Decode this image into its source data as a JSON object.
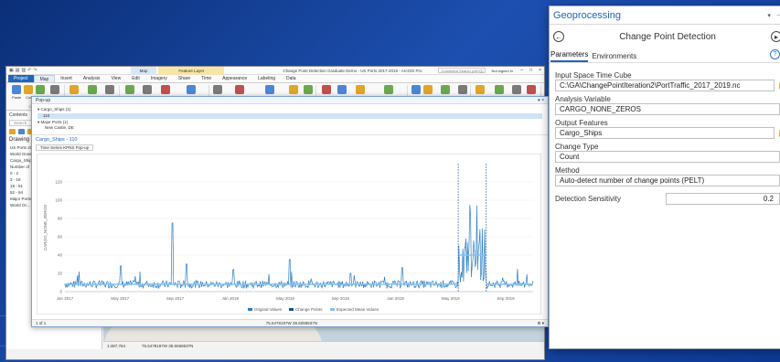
{
  "pro": {
    "window_title": "Change Point Detection Graduate Demo - US Ports 2017-2019 - ArcGIS Pro",
    "context_tabs": [
      "Map",
      "Feature Layer"
    ],
    "tabs": [
      "Project",
      "Map",
      "Insert",
      "Analysis",
      "View",
      "Edit",
      "Imagery",
      "Share",
      "Time",
      "Appearance",
      "Labeling",
      "Data"
    ],
    "active_tab": "Map",
    "search_placeholder": "Command Search (Alt+Q)",
    "signed_in": "Not signed in",
    "ribbon_groups": [
      {
        "name": "Clipboard",
        "tools": [
          "Paste",
          "Cut",
          "Copy",
          "Copy Path"
        ]
      },
      {
        "name": "Navigate",
        "tools": [
          "Explore",
          "Bookmarks",
          "Go To XY"
        ]
      },
      {
        "name": "Layer",
        "tools": [
          "Basemap",
          "Add Data",
          "Add Preset",
          "Add Graphics Layer"
        ]
      },
      {
        "name": "Selection",
        "tools": [
          "Select",
          "Select By Attributes",
          "Select By Location",
          "Attributes",
          "Clear"
        ]
      },
      {
        "name": "Inquiry",
        "tools": [
          "Measure",
          "Locate",
          "Infographics",
          "Coordinate Conversion"
        ]
      },
      {
        "name": "Labeling",
        "tools": [
          "Pause",
          "Lock",
          "View Unplaced",
          "More"
        ]
      },
      {
        "name": "Offline",
        "tools": [
          "Convert",
          "Download Map",
          "Sync",
          "Remove"
        ]
      }
    ],
    "contents": {
      "title": "Contents",
      "search_placeholder": "Search",
      "heading": "Drawing Order",
      "rows": [
        "US Ports 2017-2019",
        "World Ocean Reference",
        "Cargo_Ships",
        "Number of",
        "0 - 2",
        "3 - 18",
        "19 - 51",
        "52 - 94",
        "Major Ports",
        "World Oc..."
      ]
    },
    "map_tabs": [
      "US Ports 2017-2019",
      "Covid-19 Daily Confirmed Cases"
    ],
    "status": {
      "scale": "1:487,764",
      "coords": "75.5478197W 39.6068537N"
    }
  },
  "popup": {
    "title": "Pop-up",
    "tree": [
      "Cargo_Ships (1)",
      "110",
      "Major Ports (1)",
      "New Castle, DE"
    ],
    "feature_name": "Cargo_Ships - 110",
    "ts_tab": "Time Series KPNS Pop-up",
    "footer_left": "1 of 1",
    "footer_center": "75.5478197W 39.6068537N"
  },
  "chart_data": {
    "type": "line",
    "ylabel": "CARGO_NONE_ZEROS",
    "yticks": [
      0,
      20,
      40,
      60,
      80,
      100,
      120
    ],
    "ylim": [
      0,
      140
    ],
    "xticks": [
      "Jan 2017",
      "May 2017",
      "Sep 2017",
      "Jan 2018",
      "May 2018",
      "Sep 2018",
      "Jan 2019",
      "May 2019",
      "Sep 2019"
    ],
    "legend": [
      "Original Values",
      "Change Points",
      "Expected Mean Values"
    ],
    "baseline_level": 8,
    "late_segment": {
      "start_index": 0.84,
      "end_index": 0.9,
      "mean": 40,
      "peak": 110
    },
    "spikes": [
      {
        "pos": 0.03,
        "value": 22
      },
      {
        "pos": 0.12,
        "value": 28
      },
      {
        "pos": 0.23,
        "value": 75
      },
      {
        "pos": 0.26,
        "value": 30
      },
      {
        "pos": 0.36,
        "value": 24
      },
      {
        "pos": 0.48,
        "value": 35
      },
      {
        "pos": 0.61,
        "value": 20
      },
      {
        "pos": 0.72,
        "value": 26
      }
    ],
    "colors": {
      "line": "#2e7fc4",
      "change": "#1a4e96",
      "mean": "#87c0ec"
    }
  },
  "gp": {
    "pane_title": "Geoprocessing",
    "tool_name": "Change Point Detection",
    "tabs": [
      "Parameters",
      "Environments"
    ],
    "params": [
      {
        "label": "Input Space Time Cube",
        "value": "C:\\GA\\ChangePointIteration2\\PortTraffic_2017_2019.nc",
        "browse": true
      },
      {
        "label": "Analysis Variable",
        "value": "CARGO_NONE_ZEROS",
        "browse": false
      },
      {
        "label": "Output Features",
        "value": "Cargo_Ships",
        "browse": true
      },
      {
        "label": "Change Type",
        "value": "Count",
        "browse": false
      },
      {
        "label": "Method",
        "value": "Auto-detect number of change points (PELT)",
        "browse": false
      }
    ],
    "sensitivity_label": "Detection Sensitivity",
    "sensitivity_value": "0.2"
  },
  "colors": {
    "brand": "#1f65b8",
    "slide_bg": "#1d4fb0"
  }
}
